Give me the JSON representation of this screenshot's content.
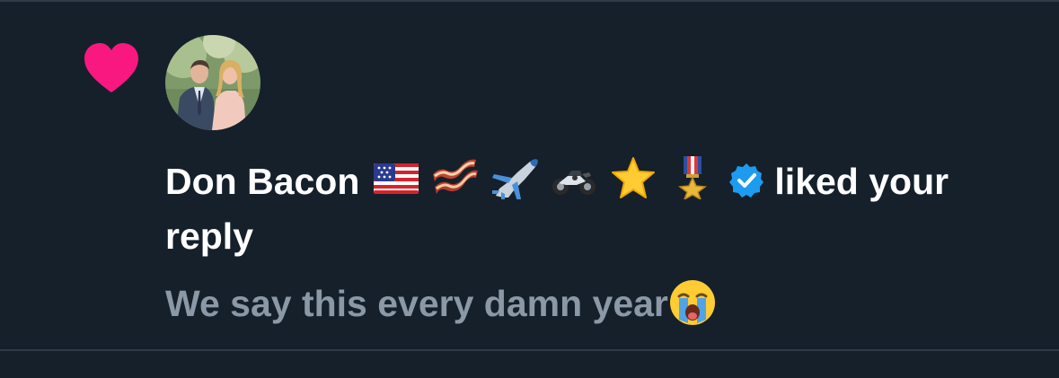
{
  "notification": {
    "type_icon": "heart-icon",
    "like_color": "#f91880",
    "avatar": "profile-photo-avatar",
    "user_name": "Don Bacon",
    "name_emojis": [
      "us-flag-emoji",
      "bacon-emoji",
      "airplane-emoji",
      "motorcycle-emoji",
      "star-emoji",
      "military-medal-emoji"
    ],
    "verified_badge": "verified-badge-icon",
    "verified_color": "#1d9bf0",
    "action_text": "liked your reply",
    "reply_snippet": "We say this every damn year",
    "snippet_emoji": "loudly-crying-face-emoji"
  },
  "colors": {
    "background": "#15202b",
    "divider": "#2f3a46",
    "primary_text": "#ffffff",
    "secondary_text": "#8b98a5"
  }
}
